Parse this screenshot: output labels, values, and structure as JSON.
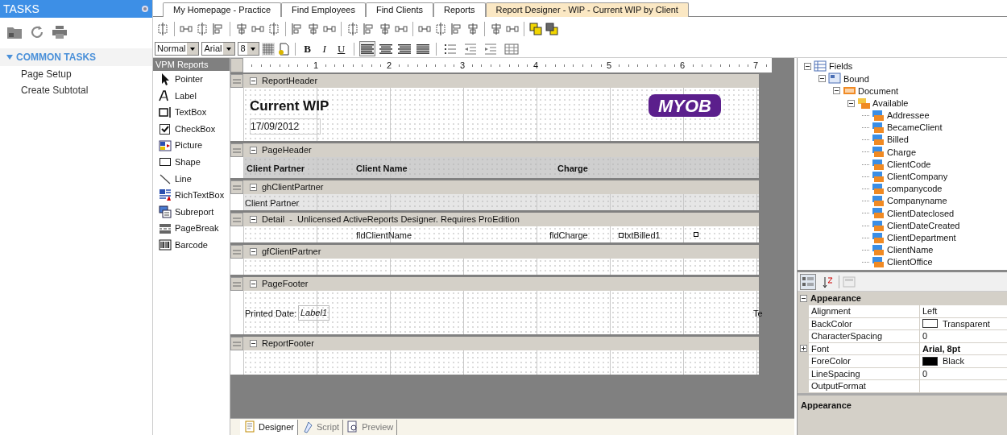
{
  "sidebar": {
    "title": "TASKS",
    "section": {
      "title": "COMMON TASKS",
      "expanded": true,
      "items": [
        "Page Setup",
        "Create Subtotal"
      ]
    }
  },
  "tabs": [
    {
      "label": "My Homepage - Practice",
      "selected": false
    },
    {
      "label": "Find Employees",
      "selected": false
    },
    {
      "label": "Find Clients",
      "selected": false
    },
    {
      "label": "Reports",
      "selected": false
    },
    {
      "label": "Report Designer - WIP - Current WIP by Client",
      "selected": true
    }
  ],
  "format_bar": {
    "style": "Normal",
    "font": "Arial",
    "size": "8",
    "text_styles": [
      "B",
      "I",
      "U"
    ],
    "alignment": [
      {
        "selected": true
      },
      {
        "selected": false
      },
      {
        "selected": false
      },
      {
        "selected": false
      }
    ]
  },
  "toolbox": {
    "title": "VPM Reports",
    "items": [
      "Pointer",
      "Label",
      "TextBox",
      "CheckBox",
      "Picture",
      "Shape",
      "Line",
      "RichTextBox",
      "Subreport",
      "PageBreak",
      "Barcode"
    ]
  },
  "ruler": [
    "1",
    "2",
    "3",
    "4",
    "5",
    "6",
    "7"
  ],
  "sections": [
    {
      "title": "ReportHeader",
      "expanded": true,
      "items": [
        {
          "kind": "title",
          "text": "Current WIP"
        },
        {
          "kind": "field",
          "text": "17/09/2012"
        },
        {
          "kind": "logo",
          "text": "MYOB"
        }
      ]
    },
    {
      "title": "PageHeader",
      "expanded": true,
      "items": [
        {
          "kind": "heading",
          "text": "Client Partner"
        },
        {
          "kind": "heading",
          "text": "Client Name"
        },
        {
          "kind": "heading",
          "text": "Charge"
        }
      ]
    },
    {
      "title": "ghClientPartner",
      "expanded": true,
      "items": [
        {
          "kind": "field",
          "text": "Client Partner"
        }
      ]
    },
    {
      "title": "Detail  -  Unlicensed ActiveReports Designer. Requires ProEdition",
      "expanded": true,
      "items": [
        {
          "kind": "field",
          "text": "fldClientName"
        },
        {
          "kind": "field",
          "text": "fldCharge"
        },
        {
          "kind": "selected",
          "text": "txtBilled1"
        }
      ]
    },
    {
      "title": "gfClientPartner",
      "expanded": true
    },
    {
      "title": "PageFooter",
      "expanded": true,
      "items": [
        {
          "kind": "field",
          "text": "Printed Date:"
        },
        {
          "kind": "italic",
          "text": "Label1"
        },
        {
          "kind": "field",
          "text": "Te"
        }
      ]
    },
    {
      "title": "ReportFooter",
      "expanded": true
    }
  ],
  "bottom_tabs": [
    {
      "label": "Designer",
      "selected": true
    },
    {
      "label": "Script",
      "selected": false
    },
    {
      "label": "Preview",
      "selected": false
    }
  ],
  "fields_tree": [
    {
      "label": "Fields",
      "expanded": true,
      "children": [
        {
          "label": "Bound",
          "expanded": true,
          "children": [
            {
              "label": "Document",
              "expanded": true,
              "children": [
                {
                  "label": "Available",
                  "expanded": true,
                  "children": [
                    {
                      "label": "Addressee"
                    },
                    {
                      "label": "BecameClient"
                    },
                    {
                      "label": "Billed"
                    },
                    {
                      "label": "Charge"
                    },
                    {
                      "label": "ClientCode"
                    },
                    {
                      "label": "ClientCompany"
                    },
                    {
                      "label": "companycode"
                    },
                    {
                      "label": "Companyname"
                    },
                    {
                      "label": "ClientDateclosed"
                    },
                    {
                      "label": "ClientDateCreated"
                    },
                    {
                      "label": "ClientDepartment"
                    },
                    {
                      "label": "ClientName"
                    },
                    {
                      "label": "ClientOffice"
                    }
                  ]
                }
              ]
            }
          ]
        }
      ]
    }
  ],
  "properties": {
    "toolbar": [
      {
        "selected": true
      },
      {
        "selected": false
      }
    ],
    "category": {
      "title": "Appearance",
      "expanded": true
    },
    "rows": [
      {
        "name": "Alignment",
        "value": "Left"
      },
      {
        "name": "BackColor",
        "value": "Transparent",
        "color": "#ffffff"
      },
      {
        "name": "CharacterSpacing",
        "value": "0"
      },
      {
        "name": "Font",
        "value": "Arial, 8pt",
        "expanded": false
      },
      {
        "name": "ForeColor",
        "value": "Black",
        "color": "#000000"
      },
      {
        "name": "LineSpacing",
        "value": "0"
      },
      {
        "name": "OutputFormat"
      }
    ],
    "description": "Appearance"
  }
}
